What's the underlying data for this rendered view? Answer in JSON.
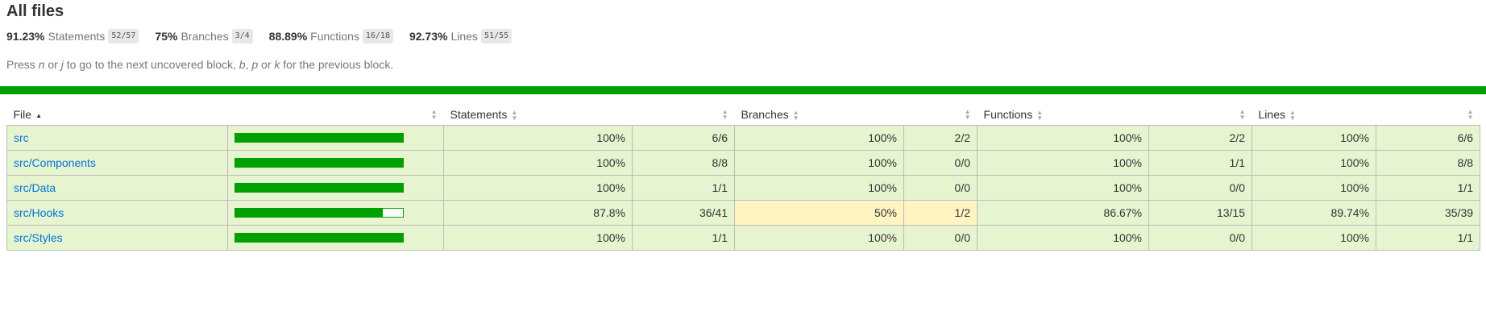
{
  "title": "All files",
  "summary": [
    {
      "pct": "91.23%",
      "label": "Statements",
      "fraction": "52/57"
    },
    {
      "pct": "75%",
      "label": "Branches",
      "fraction": "3/4"
    },
    {
      "pct": "88.89%",
      "label": "Functions",
      "fraction": "16/18"
    },
    {
      "pct": "92.73%",
      "label": "Lines",
      "fraction": "51/55"
    }
  ],
  "hint": {
    "press": "Press ",
    "k1": "n",
    "or1": " or ",
    "k2": "j",
    "mid": " to go to the next uncovered block, ",
    "k3": "b",
    "comma": ", ",
    "k4": "p",
    "or2": " or ",
    "k5": "k",
    "end": " for the previous block."
  },
  "colors": {
    "high": "#e6f5d0",
    "medium": "#fff4c2",
    "bar": "#00a000",
    "link": "#0074d9"
  },
  "table": {
    "headers": {
      "file": "File",
      "statements": "Statements",
      "branches": "Branches",
      "functions": "Functions",
      "lines": "Lines"
    },
    "rows": [
      {
        "file": "src",
        "coverage": 1.0,
        "stmt_pct": "100%",
        "stmt_abs": "6/6",
        "br_pct": "100%",
        "br_abs": "2/2",
        "fn_pct": "100%",
        "fn_abs": "2/2",
        "ln_pct": "100%",
        "ln_abs": "6/6"
      },
      {
        "file": "src/Components",
        "coverage": 1.0,
        "stmt_pct": "100%",
        "stmt_abs": "8/8",
        "br_pct": "100%",
        "br_abs": "0/0",
        "fn_pct": "100%",
        "fn_abs": "1/1",
        "ln_pct": "100%",
        "ln_abs": "8/8"
      },
      {
        "file": "src/Data",
        "coverage": 1.0,
        "stmt_pct": "100%",
        "stmt_abs": "1/1",
        "br_pct": "100%",
        "br_abs": "0/0",
        "fn_pct": "100%",
        "fn_abs": "0/0",
        "ln_pct": "100%",
        "ln_abs": "1/1"
      },
      {
        "file": "src/Hooks",
        "coverage": 0.878,
        "stmt_pct": "87.8%",
        "stmt_abs": "36/41",
        "br_pct": "50%",
        "br_abs": "1/2",
        "fn_pct": "86.67%",
        "fn_abs": "13/15",
        "ln_pct": "89.74%",
        "ln_abs": "35/39"
      },
      {
        "file": "src/Styles",
        "coverage": 1.0,
        "stmt_pct": "100%",
        "stmt_abs": "1/1",
        "br_pct": "100%",
        "br_abs": "0/0",
        "fn_pct": "100%",
        "fn_abs": "0/0",
        "ln_pct": "100%",
        "ln_abs": "1/1"
      }
    ]
  }
}
